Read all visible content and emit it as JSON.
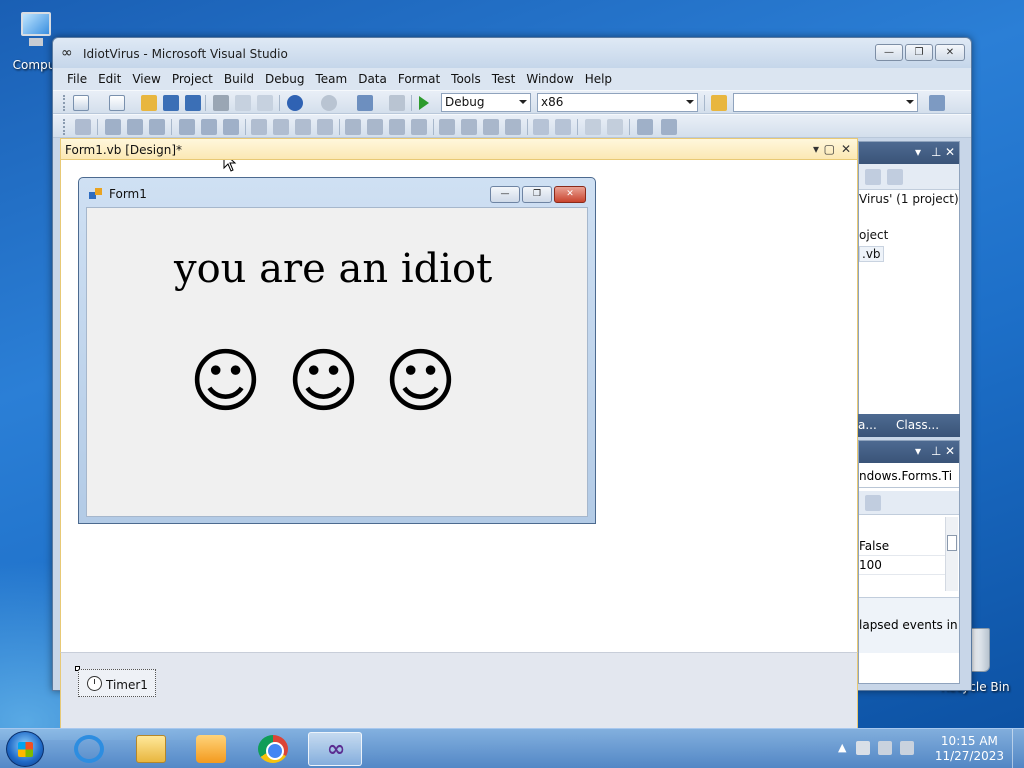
{
  "desktop": {
    "computer_label": "Compu",
    "recycle_label": "Recycle Bin"
  },
  "vs": {
    "title": "IdiotVirus - Microsoft Visual Studio",
    "menu": [
      "File",
      "Edit",
      "View",
      "Project",
      "Build",
      "Debug",
      "Team",
      "Data",
      "Format",
      "Tools",
      "Test",
      "Window",
      "Help"
    ],
    "config_combo": "Debug",
    "platform_combo": "x86",
    "find_combo": ""
  },
  "doc": {
    "tab_label": "Form1.vb [Design]*"
  },
  "form1": {
    "title": "Form1",
    "label_text": "you are an idiot",
    "smileys": [
      "☺",
      "☺",
      "☺"
    ]
  },
  "tray": {
    "timer_label": "Timer1"
  },
  "solution_panel": {
    "line1": "Virus' (1 project)",
    "line2": "oject",
    "line3": ".vb",
    "tab1": "a...",
    "tab2": "Class..."
  },
  "properties_panel": {
    "object_combo": "ndows.Forms.Ti",
    "rows": [
      "False",
      "100"
    ],
    "description": "lapsed events in"
  },
  "taskbar": {
    "time": "10:15 AM",
    "date": "11/27/2023"
  },
  "colors": {
    "accent": "#3a5478",
    "doc_tab": "#fbe8b4"
  }
}
